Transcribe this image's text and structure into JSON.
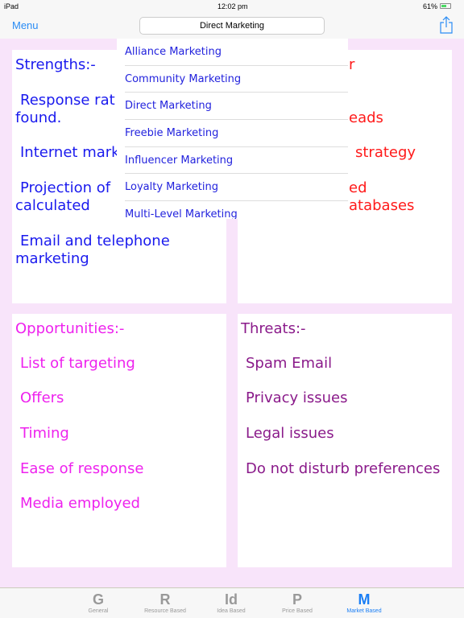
{
  "status": {
    "device": "iPad",
    "time": "12:02 pm",
    "battery": "61%"
  },
  "nav": {
    "menu": "Menu",
    "title": "Direct Marketing",
    "share_icon": "share-icon"
  },
  "strengths": {
    "title": "Strengths:-",
    "lines": [
      "Response rat",
      "found.",
      "Internet mark",
      "Projection of",
      "calculated",
      "Email and telephone",
      "marketing"
    ]
  },
  "weaknesses": {
    "lines": [
      "r",
      "eads",
      "strategy",
      "ed",
      "atabases"
    ]
  },
  "opportunities": {
    "title": "Opportunities:-",
    "items": [
      "List of targeting",
      "Offers",
      "Timing",
      "Ease of response",
      "Media employed"
    ]
  },
  "threats": {
    "title": "Threats:-",
    "items": [
      "Spam Email",
      "Privacy issues",
      "Legal issues",
      "Do not disturb preferences"
    ]
  },
  "dropdown": {
    "items": [
      "Alliance Marketing",
      "Community Marketing",
      "Direct Marketing",
      "Freebie Marketing",
      "Influencer Marketing",
      "Loyalty Marketing",
      "Multi-Level Marketing"
    ]
  },
  "tabs": [
    {
      "letter": "G",
      "label": "General"
    },
    {
      "letter": "R",
      "label": "Resource Based"
    },
    {
      "letter": "Id",
      "label": "Idea Based"
    },
    {
      "letter": "P",
      "label": "Price Based"
    },
    {
      "letter": "M",
      "label": "Market Based",
      "active": true
    }
  ],
  "colors": {
    "strengths": "#1a1aee",
    "weaknesses": "#ff1a1a",
    "opportunities": "#ee22ee",
    "threats": "#8a1a8a",
    "accent": "#1a7ef5"
  }
}
